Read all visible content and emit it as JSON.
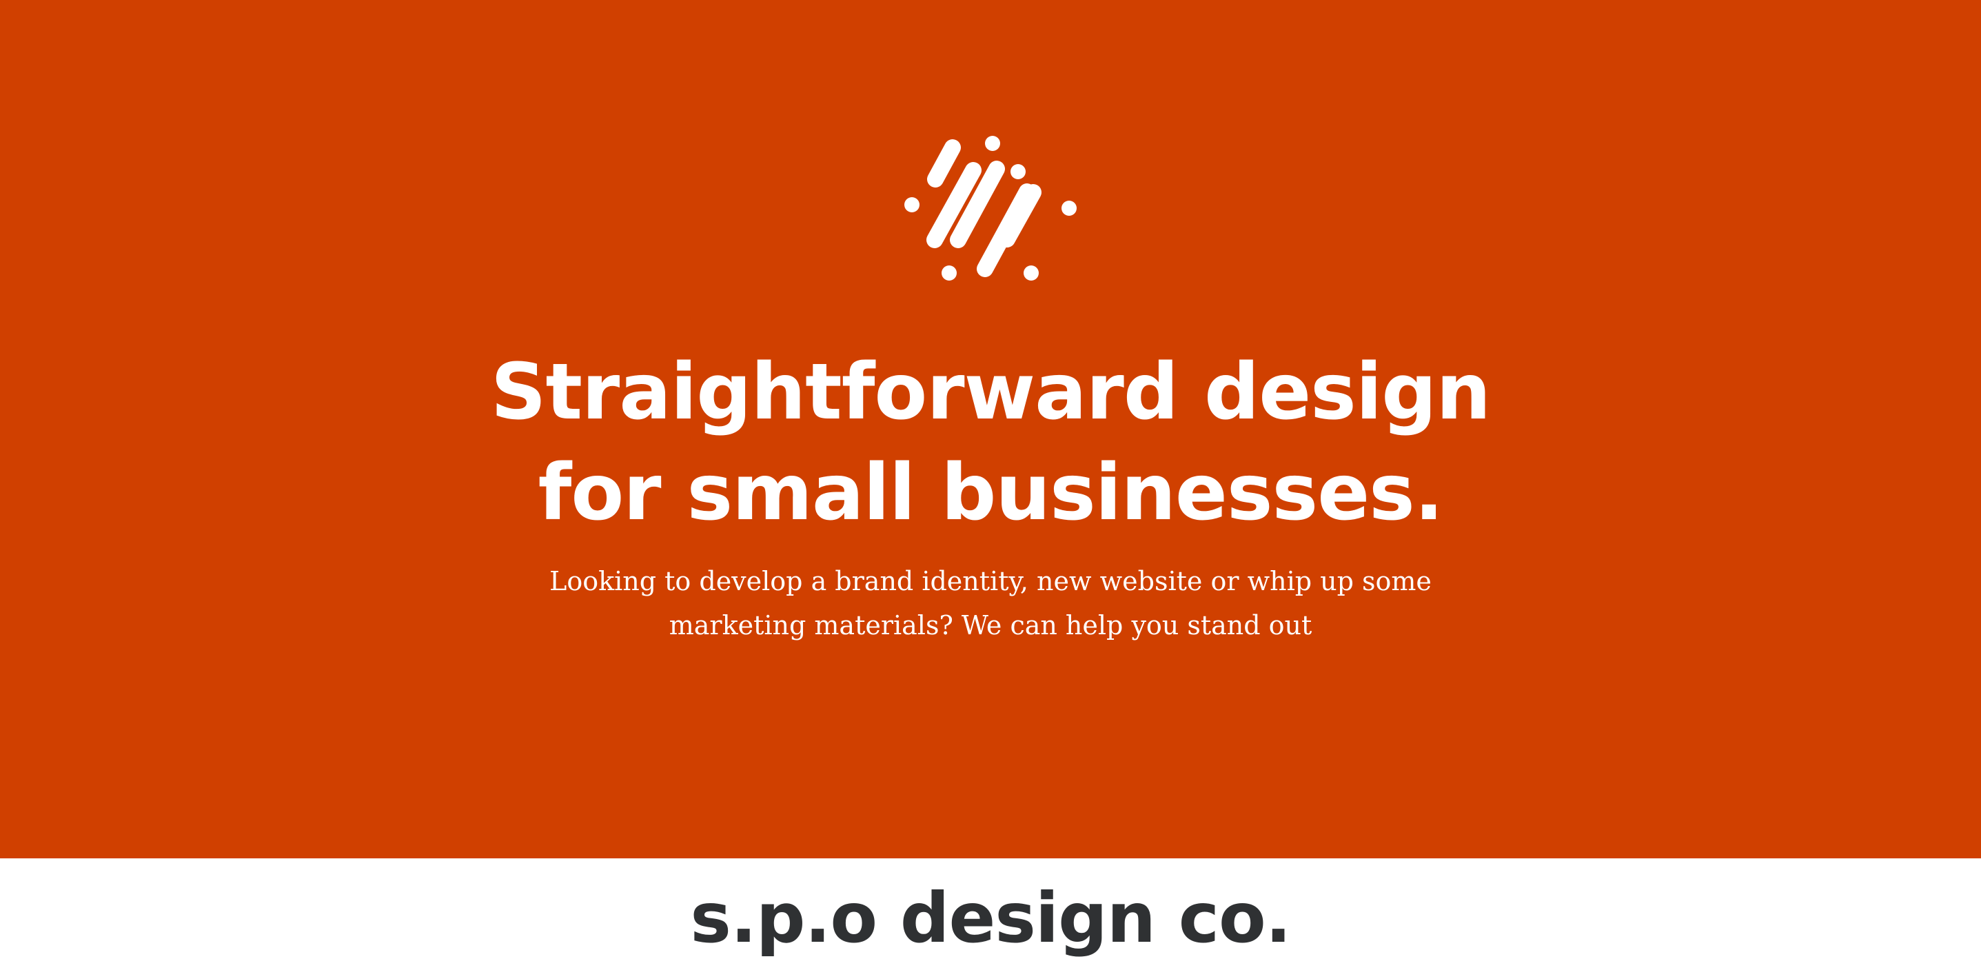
{
  "hero": {
    "logo_icon": "diagonal-lines-logo-icon",
    "headline_line1": "Straightforward design",
    "headline_line2": "for small businesses.",
    "subtext_line1": "Looking to develop a brand identity, new website or whip up some",
    "subtext_line2": "marketing materials? We can help you stand out"
  },
  "footer": {
    "brand_name": "s.p.o design co."
  },
  "colors": {
    "hero_background": "#d04000",
    "hero_text": "#ffffff",
    "brand_text": "#2f3133",
    "footer_background": "#ffffff"
  }
}
